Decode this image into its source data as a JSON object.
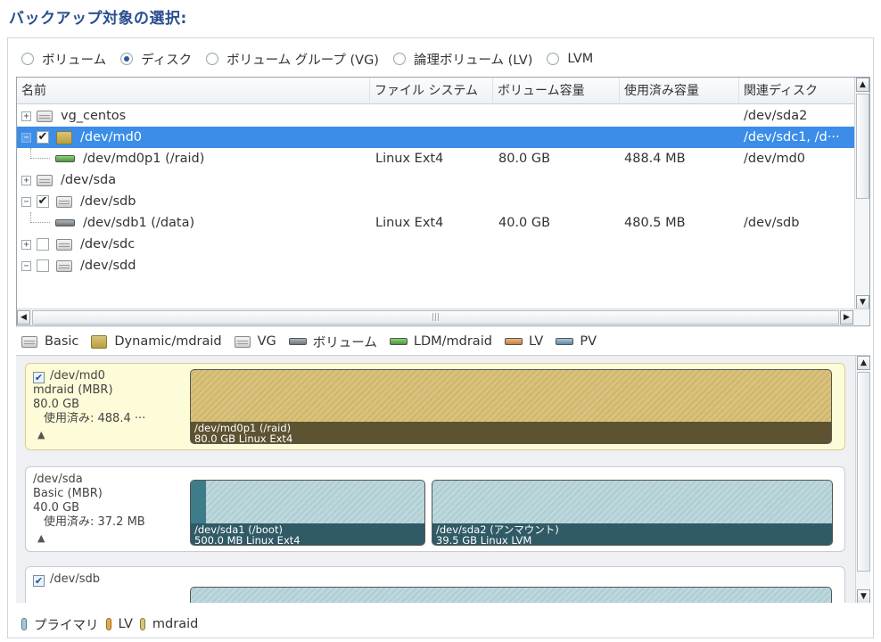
{
  "title": "バックアップ対象の選択:",
  "radio_options": [
    {
      "label": "ボリューム",
      "checked": false
    },
    {
      "label": "ディスク",
      "checked": true
    },
    {
      "label": "ボリューム グループ (VG)",
      "checked": false
    },
    {
      "label": "論理ボリューム (LV)",
      "checked": false
    },
    {
      "label": "LVM",
      "checked": false
    }
  ],
  "table": {
    "headers": [
      "名前",
      "ファイル システム",
      "ボリューム容量",
      "使用済み容量",
      "関連ディスク"
    ],
    "rows": [
      {
        "name": "vg_centos",
        "fs": "",
        "capacity": "",
        "used": "",
        "disk": "/dev/sda2"
      },
      {
        "name": "/dev/md0",
        "fs": "",
        "capacity": "",
        "used": "",
        "disk": "/dev/sdc1, /d···"
      },
      {
        "name": "/dev/md0p1 (/raid)",
        "fs": "Linux Ext4",
        "capacity": "80.0 GB",
        "used": "488.4 MB",
        "disk": "/dev/md0"
      },
      {
        "name": "/dev/sda",
        "fs": "",
        "capacity": "",
        "used": "",
        "disk": ""
      },
      {
        "name": "/dev/sdb",
        "fs": "",
        "capacity": "",
        "used": "",
        "disk": ""
      },
      {
        "name": "/dev/sdb1 (/data)",
        "fs": "Linux Ext4",
        "capacity": "40.0 GB",
        "used": "480.5 MB",
        "disk": "/dev/sdb"
      },
      {
        "name": "/dev/sdc",
        "fs": "",
        "capacity": "",
        "used": "",
        "disk": ""
      },
      {
        "name": "/dev/sdd",
        "fs": "",
        "capacity": "",
        "used": "",
        "disk": ""
      }
    ],
    "expander_expanded": "−",
    "expander_collapsed": "+",
    "check_mark": "✔"
  },
  "legend": [
    "Basic",
    "Dynamic/mdraid",
    "VG",
    "ボリューム",
    "LDM/mdraid",
    "LV",
    "PV"
  ],
  "disks": [
    {
      "name": "/dev/md0",
      "type": "mdraid (MBR)",
      "size": "80.0 GB",
      "used": "使用済み: 488.4 ···",
      "partitions": [
        {
          "label": "/dev/md0p1 (/raid)",
          "detail": "80.0 GB Linux Ext4"
        }
      ]
    },
    {
      "name": "/dev/sda",
      "type": "Basic (MBR)",
      "size": "40.0 GB",
      "used": "使用済み: 37.2 MB",
      "partitions": [
        {
          "label": "/dev/sda1 (/boot)",
          "detail": "500.0 MB Linux Ext4"
        },
        {
          "label": "/dev/sda2 (アンマウント)",
          "detail": "39.5 GB Linux LVM"
        }
      ]
    },
    {
      "name": "/dev/sdb"
    }
  ],
  "bottom_legend": [
    "プライマリ",
    "LV",
    "mdraid"
  ],
  "colors": {
    "title": "#2a4f8f",
    "selection": "#3b8de8",
    "primary": "#a8c8da",
    "lv": "#e5a94a",
    "mdraid": "#d9c27d"
  }
}
